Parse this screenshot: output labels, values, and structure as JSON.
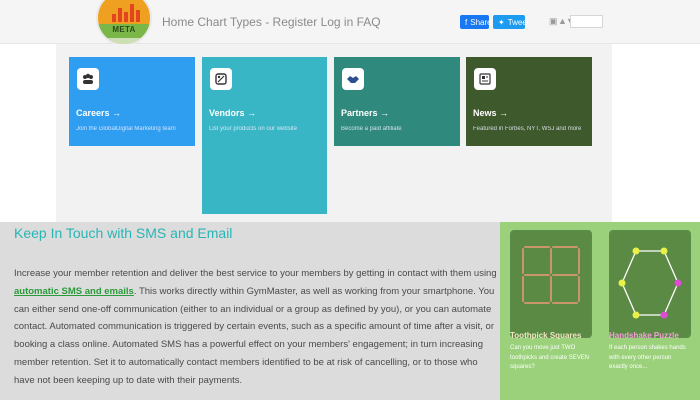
{
  "header": {
    "logo_text": "META",
    "nav": [
      "Home",
      "Chart Types",
      "-",
      "Register",
      "Log in",
      "FAQ"
    ],
    "share_fb": "Share",
    "share_tw": "Tweet"
  },
  "cards": [
    {
      "title": "Careers →",
      "subtitle": "Join the GlobalDigital Marketing team",
      "icon": "users-icon",
      "color": "#2f9ef0"
    },
    {
      "title": "Vendors →",
      "subtitle": "List your products on our website",
      "icon": "tag-icon",
      "color": "#39b6c6"
    },
    {
      "title": "Partners →",
      "subtitle": "Become a paid affiliate",
      "icon": "handshake-icon",
      "color": "#2f8a7d"
    },
    {
      "title": "News →",
      "subtitle": "Featured in Forbes, NYT, WSJ and more",
      "icon": "news-icon",
      "color": "#3e5a2d"
    }
  ],
  "main": {
    "heading": "Keep In Touch with SMS and Email",
    "para_part1": "Increase your member retention and deliver the best service to your members by getting in contact with them using ",
    "para_highlight": "automatic SMS and emails",
    "para_part2": ". This works directly within GymMaster, as well as working from your smartphone. You can either send one-off communication (either to an individual or a group as defined by you), or you can automate contact. Automated communication is triggered by certain events, such as a specific amount of time after a visit, or booking a class online. Automated SMS has a powerful effect on your members' engagement; in turn increasing member retention. Set it to automatically contact members identified to be at risk of cancelling, or to those who have not been keeping up to date with their payments."
  },
  "puzzles": [
    {
      "title": "Toothpick Squares",
      "desc": "Can you move just TWO toothpicks and create SEVEN squares?"
    },
    {
      "title": "Handshake Puzzle",
      "desc": "If each person shakes hands with every other person exactly once..."
    }
  ]
}
